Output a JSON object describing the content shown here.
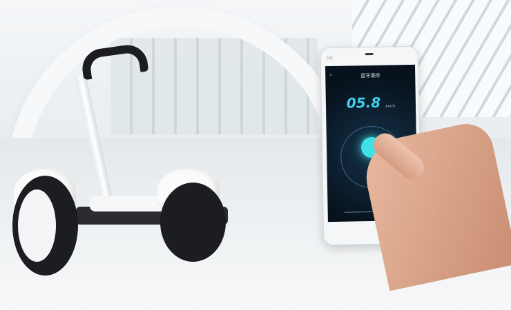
{
  "phone": {
    "brand": "MI",
    "screen_title": "蓝牙遥控",
    "back_icon": "chevron-left-icon",
    "speed_value": "05.8",
    "speed_unit": "km/h"
  }
}
